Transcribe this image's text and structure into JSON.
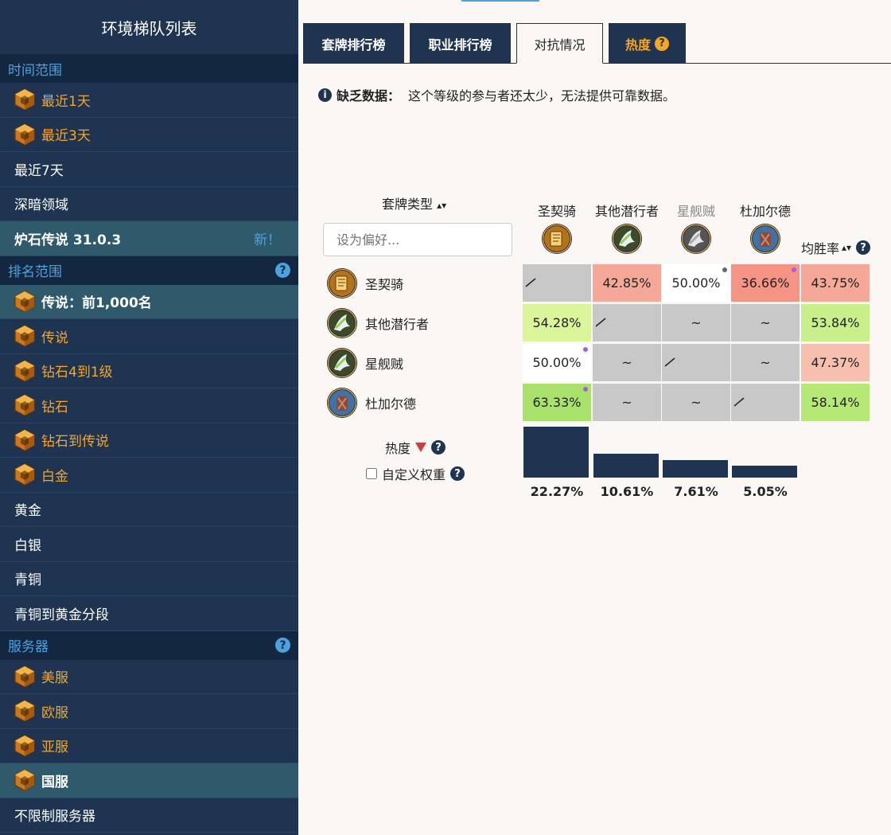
{
  "sidebar": {
    "title": "环境梯队列表",
    "time_section": "时间范围",
    "time_items": [
      {
        "label": "最近1天",
        "premium": true
      },
      {
        "label": "最近3天",
        "premium": true
      },
      {
        "label": "最近7天",
        "premium": false
      },
      {
        "label": "深暗领域",
        "premium": false
      }
    ],
    "version_item": {
      "label": "炉石传说 31.0.3",
      "badge": "新！"
    },
    "rank_section": "排名范围",
    "rank_items": [
      {
        "label": "传说：前1,000名",
        "premium": true,
        "active": true
      },
      {
        "label": "传说",
        "premium": true
      },
      {
        "label": "钻石4到1级",
        "premium": true
      },
      {
        "label": "钻石",
        "premium": true
      },
      {
        "label": "钻石到传说",
        "premium": true
      },
      {
        "label": "白金",
        "premium": true
      },
      {
        "label": "黄金",
        "premium": false
      },
      {
        "label": "白银",
        "premium": false
      },
      {
        "label": "青铜",
        "premium": false
      },
      {
        "label": "青铜到黄金分段",
        "premium": false
      }
    ],
    "server_section": "服务器",
    "server_items": [
      {
        "label": "美服",
        "premium": true
      },
      {
        "label": "欧服",
        "premium": true
      },
      {
        "label": "亚服",
        "premium": true
      },
      {
        "label": "国服",
        "premium": true,
        "active": true
      },
      {
        "label": "不限制服务器",
        "premium": false
      }
    ],
    "help_glyph": "?"
  },
  "tabs": {
    "deck_ranking": "套牌排行榜",
    "class_ranking": "职业排行榜",
    "matchups": "对抗情况",
    "popularity": "热度",
    "help_glyph": "?"
  },
  "notice": {
    "info_glyph": "i",
    "title": "缺乏数据：",
    "text": "这个等级的参与者还太少，无法提供可靠数据。"
  },
  "matrix": {
    "deck_type_label": "套牌类型",
    "sort_glyph": "▴▾",
    "input_placeholder": "设为偏好...",
    "avg_label": "均胜率",
    "columns": [
      {
        "name": "圣契骑",
        "dim": false,
        "icon": "paladin"
      },
      {
        "name": "其他潜行者",
        "dim": false,
        "icon": "rogue"
      },
      {
        "name": "星舰贼",
        "dim": true,
        "icon": "rogue-gray"
      },
      {
        "name": "杜加尔德",
        "dim": false,
        "icon": "dugald"
      }
    ],
    "rows": [
      {
        "name": "圣契骑",
        "icon": "paladin",
        "cells": [
          {
            "v": "",
            "c": "#c8c8c8",
            "slash": true
          },
          {
            "v": "42.85%",
            "c": "#f5a898"
          },
          {
            "v": "50.00%",
            "c": "#ffffff",
            "dot": "#666"
          },
          {
            "v": "36.66%",
            "c": "#f59484",
            "dot": "#a060e0"
          }
        ],
        "avg": {
          "v": "43.75%",
          "c": "#f5a898"
        }
      },
      {
        "name": "其他潜行者",
        "icon": "rogue",
        "cells": [
          {
            "v": "54.28%",
            "c": "#dbf59a"
          },
          {
            "v": "",
            "c": "#c8c8c8",
            "slash": true
          },
          {
            "v": "~",
            "c": "#c8c8c8"
          },
          {
            "v": "~",
            "c": "#c8c8c8"
          }
        ],
        "avg": {
          "v": "53.84%",
          "c": "#c9ef8a"
        }
      },
      {
        "name": "星舰贼",
        "icon": "rogue",
        "cells": [
          {
            "v": "50.00%",
            "c": "#ffffff",
            "dot": "#a060e0"
          },
          {
            "v": "~",
            "c": "#c8c8c8"
          },
          {
            "v": "",
            "c": "#c8c8c8",
            "slash": true
          },
          {
            "v": "~",
            "c": "#c8c8c8"
          }
        ],
        "avg": {
          "v": "47.37%",
          "c": "#f7c0ae"
        }
      },
      {
        "name": "杜加尔德",
        "icon": "dugald",
        "cells": [
          {
            "v": "63.33%",
            "c": "#a9e26a",
            "dot": "#a060e0"
          },
          {
            "v": "~",
            "c": "#c8c8c8"
          },
          {
            "v": "~",
            "c": "#c8c8c8"
          },
          {
            "v": "",
            "c": "#c8c8c8",
            "slash": true
          }
        ],
        "avg": {
          "v": "58.14%",
          "c": "#b5e874"
        }
      }
    ]
  },
  "popularity": {
    "label": "热度",
    "custom_weight": "自定义权重",
    "values": [
      22.27,
      10.61,
      7.61,
      5.05
    ],
    "labels": [
      "22.27%",
      "10.61%",
      "7.61%",
      "5.05%"
    ],
    "max": 22.27
  }
}
